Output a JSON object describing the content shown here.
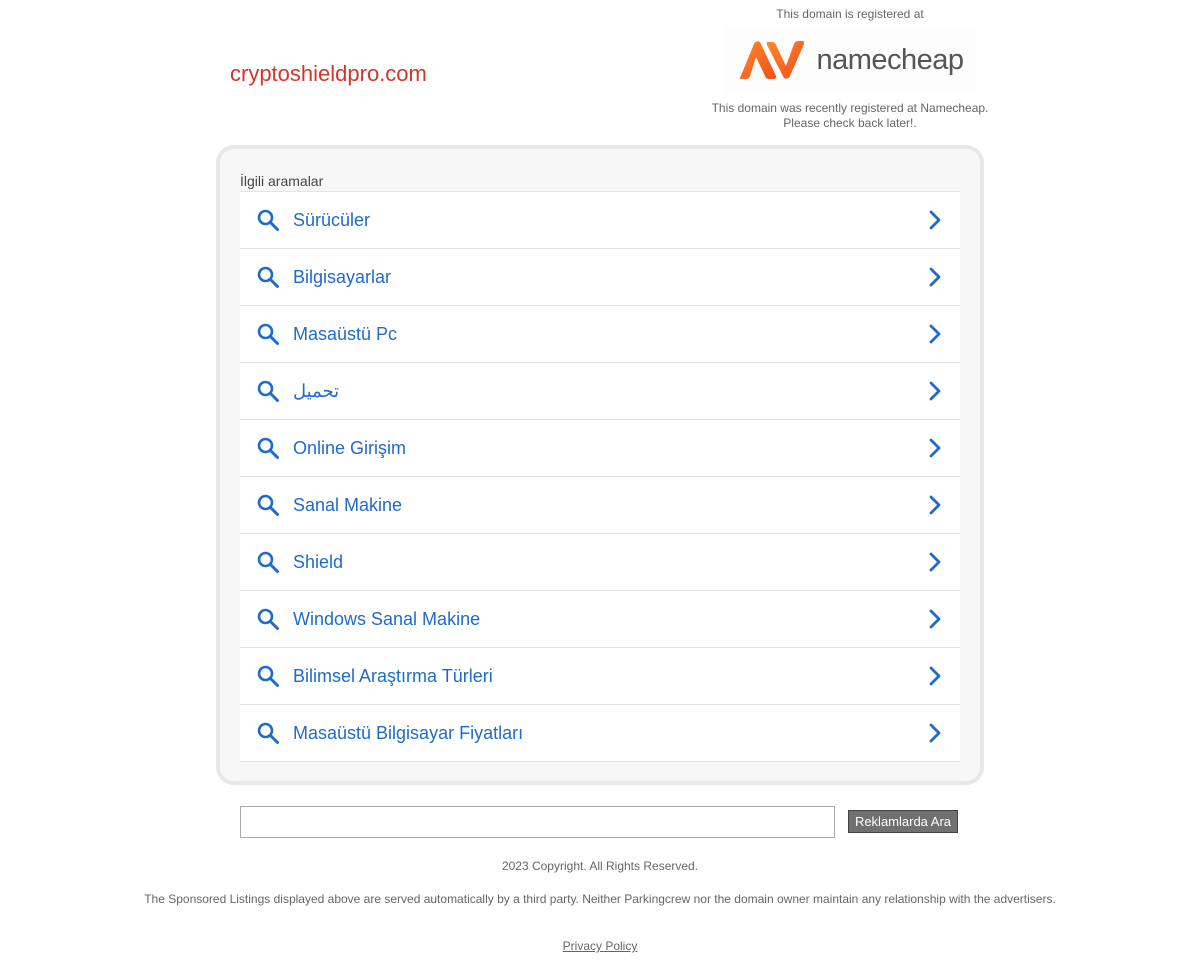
{
  "header": {
    "domain": "cryptoshieldpro.com",
    "registrar_label": "This domain is registered at",
    "registrar_logo_text": "namecheap",
    "registrar_message_line1": "This domain was recently registered at Namecheap.",
    "registrar_message_line2": "Please check back later!."
  },
  "related": {
    "title": "İlgili aramalar",
    "items": [
      {
        "label": "Sürücüler"
      },
      {
        "label": "Bilgisayarlar"
      },
      {
        "label": "Masaüstü Pc"
      },
      {
        "label": "تحميل"
      },
      {
        "label": "Online Girişim"
      },
      {
        "label": "Sanal Makine"
      },
      {
        "label": "Shield"
      },
      {
        "label": "Windows Sanal Makine"
      },
      {
        "label": "Bilimsel Araştırma Türleri"
      },
      {
        "label": "Masaüstü Bilgisayar Fiyatları"
      }
    ]
  },
  "search": {
    "value": "",
    "button_label": "Reklamlarda Ara"
  },
  "footer": {
    "copyright": "2023 Copyright. All Rights Reserved.",
    "disclaimer": "The Sponsored Listings displayed above are served automatically by a third party. Neither Parkingcrew nor the domain owner maintain any relationship with the advertisers.",
    "privacy_label": "Privacy Policy"
  },
  "colors": {
    "domain": "#d2362a",
    "link_blue": "#1f6bc9",
    "logo_orange": "#ff6a1a"
  },
  "icons": {
    "row_icon": "search-icon",
    "row_arrow": "chevron-right-icon",
    "logo": "namecheap-logo-icon"
  }
}
